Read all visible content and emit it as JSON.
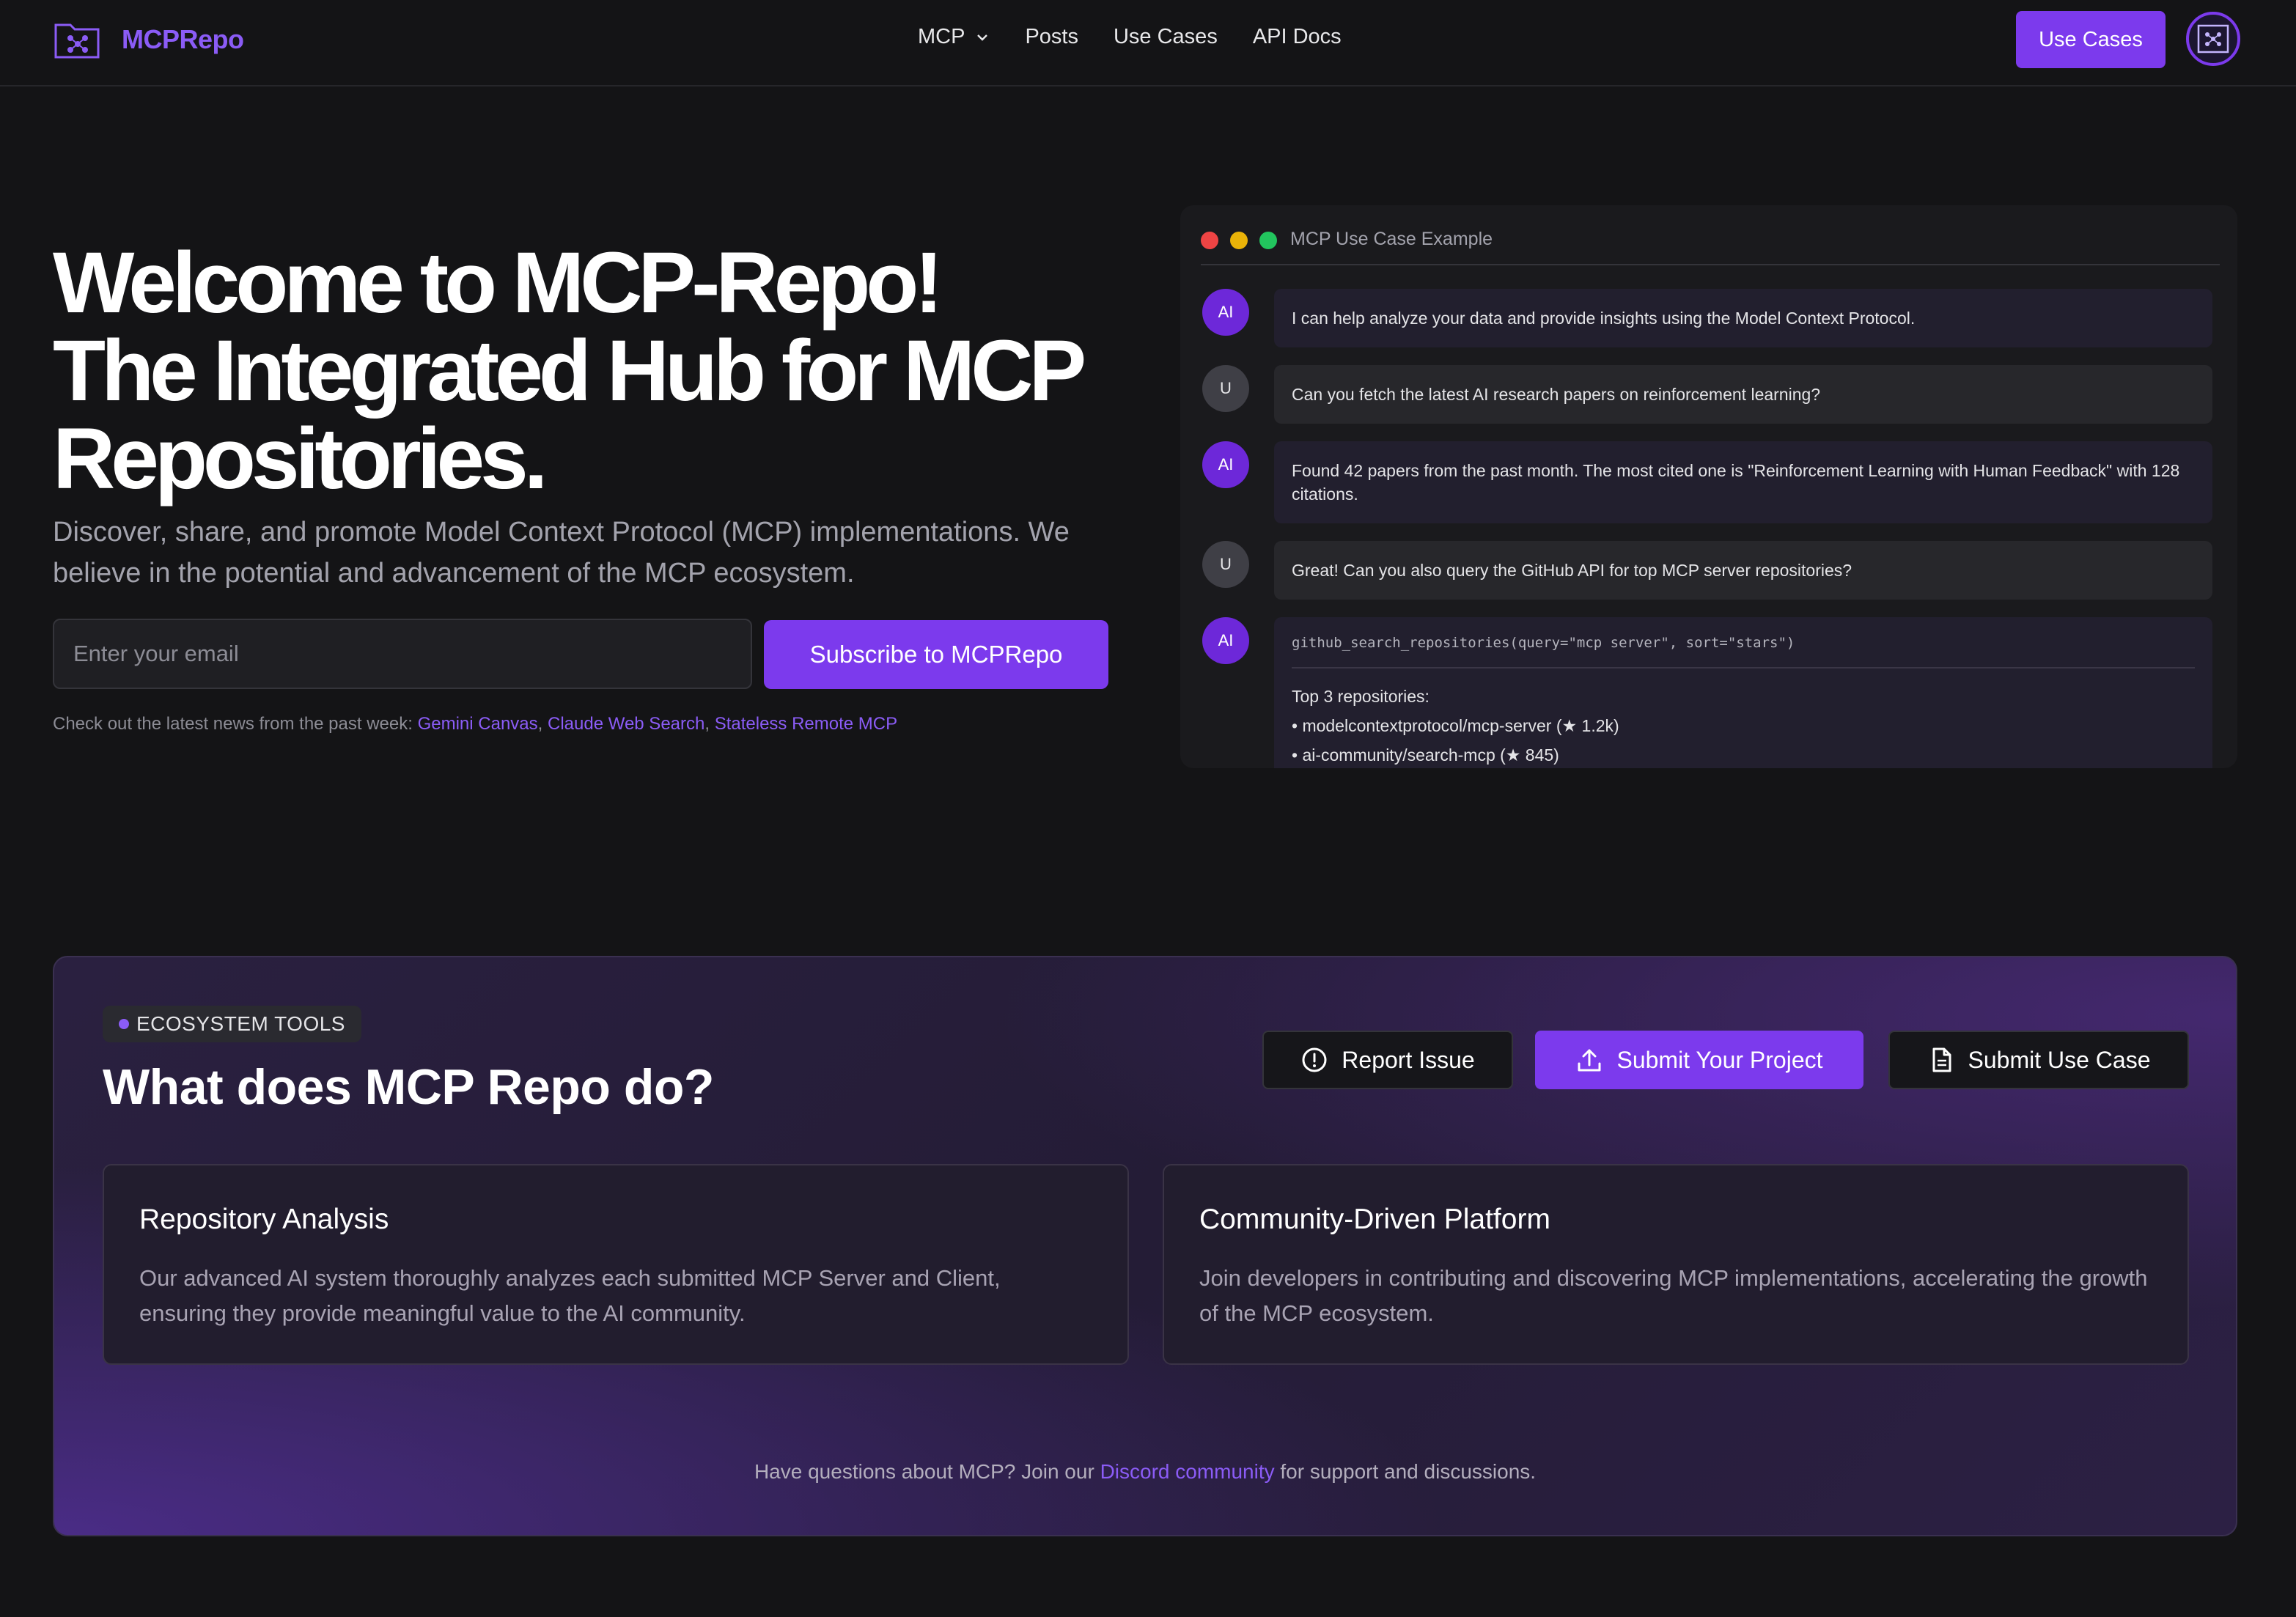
{
  "brand": {
    "name": "MCPRepo"
  },
  "nav": {
    "links": [
      {
        "label": "MCP",
        "has_dropdown": true
      },
      {
        "label": "Posts"
      },
      {
        "label": "Use Cases"
      },
      {
        "label": "API Docs"
      }
    ],
    "cta_label": "Use Cases"
  },
  "hero": {
    "title_line1": "Welcome to MCP-Repo!",
    "title_line2": "The Integrated Hub for MCP",
    "title_line3": "Repositories.",
    "subtitle": "Discover, share, and promote Model Context Protocol (MCP) implementations. We believe in the potential and advancement of the MCP ecosystem.",
    "email_placeholder": "Enter your email",
    "subscribe_label": "Subscribe to MCPRepo",
    "news_prefix": "Check out the latest news from the past week:",
    "news_links": [
      "Gemini Canvas",
      "Claude Web Search",
      "Stateless Remote MCP"
    ]
  },
  "chat": {
    "title": "MCP Use Case Example",
    "dot_colors": [
      "#ef4444",
      "#eab308",
      "#22c55e"
    ],
    "messages": [
      {
        "role": "AI",
        "text": "I can help analyze your data and provide insights using the Model Context Protocol."
      },
      {
        "role": "U",
        "text": "Can you fetch the latest AI research papers on reinforcement learning?"
      },
      {
        "role": "AI",
        "text": "Found 42 papers from the past month. The most cited one is \"Reinforcement Learning with Human Feedback\" with 128 citations."
      },
      {
        "role": "U",
        "text": "Great! Can you also query the GitHub API for top MCP server repositories?"
      }
    ],
    "code_message": {
      "role": "AI",
      "code": "github_search_repositories(query=\"mcp server\", sort=\"stars\")",
      "result_title": "Top 3 repositories:",
      "results": [
        "• modelcontextprotocol/mcp-server (★ 1.2k)",
        "• ai-community/search-mcp (★ 845)"
      ]
    }
  },
  "ecosystem": {
    "badge": "ECOSYSTEM TOOLS",
    "title": "What does MCP Repo do?",
    "buttons": {
      "report": "Report Issue",
      "submit_project": "Submit Your Project",
      "submit_use_case": "Submit Use Case"
    },
    "cards": [
      {
        "title": "Repository Analysis",
        "text": "Our advanced AI system thoroughly analyzes each submitted MCP Server and Client, ensuring they provide meaningful value to the AI community."
      },
      {
        "title": "Community-Driven Platform",
        "text": "Join developers in contributing and discovering MCP implementations, accelerating the growth of the MCP ecosystem."
      }
    ],
    "footer_prefix": "Have questions about MCP? Join our",
    "footer_link": "Discord community",
    "footer_suffix": "for support and discussions."
  },
  "colors": {
    "accent": "#7c3aed",
    "accent_text": "#8b5cf6",
    "background": "#141416"
  }
}
